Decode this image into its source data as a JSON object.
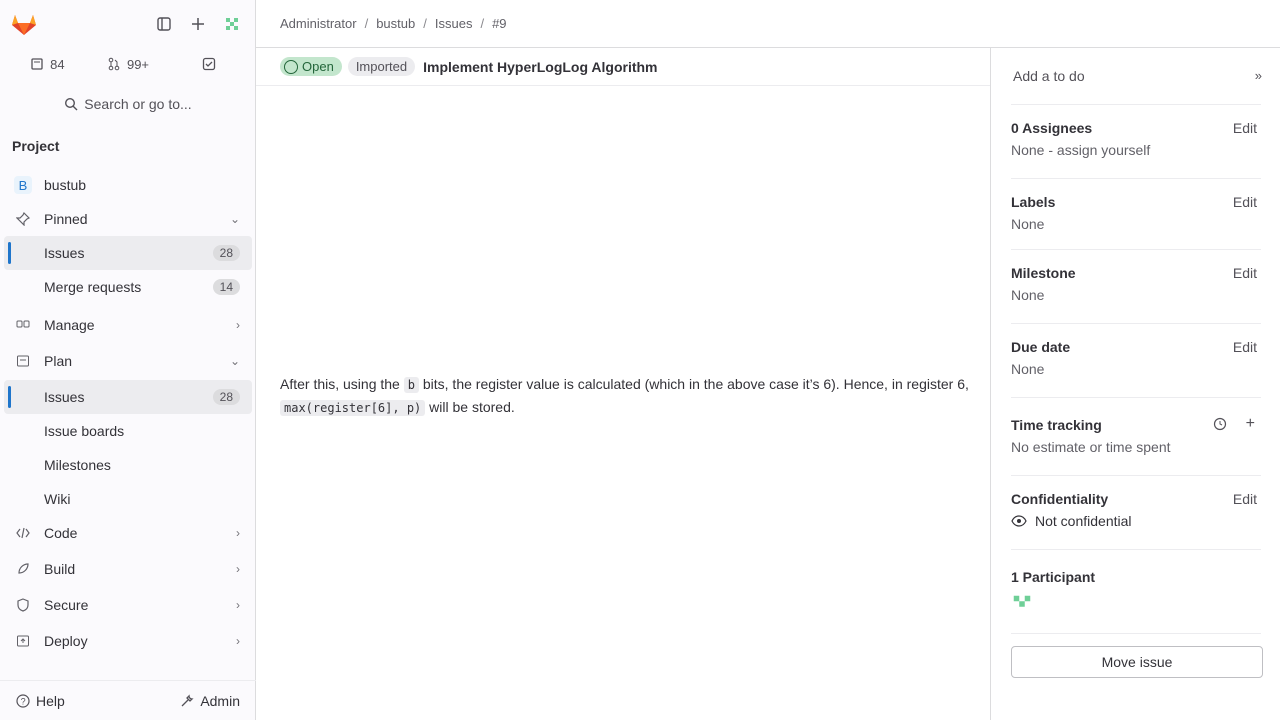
{
  "sidebar": {
    "counters": {
      "issues": "84",
      "merge_requests": "99+"
    },
    "search_label": "Search or go to...",
    "section_title": "Project",
    "project_avatar_letter": "B",
    "project_name": "bustub",
    "items": {
      "pinned": "Pinned",
      "pinned_issues": "Issues",
      "pinned_issues_count": "28",
      "pinned_mr": "Merge requests",
      "pinned_mr_count": "14",
      "manage": "Manage",
      "plan": "Plan",
      "plan_issues": "Issues",
      "plan_issues_count": "28",
      "issue_boards": "Issue boards",
      "milestones": "Milestones",
      "wiki": "Wiki",
      "code": "Code",
      "build": "Build",
      "secure": "Secure",
      "deploy": "Deploy"
    },
    "help": "Help",
    "admin": "Admin"
  },
  "breadcrumb": [
    "Administrator",
    "bustub",
    "Issues",
    "#9"
  ],
  "issue": {
    "status": "Open",
    "imported": "Imported",
    "title": "Implement HyperLogLog Algorithm"
  },
  "content": {
    "para_a": "After this, using the ",
    "code_b": "b",
    "para_b": " bits, the register value is calculated (which in the above case it’s 6). Hence, in register 6, ",
    "code_max": "max(register[6], p)",
    "para_c": " will be stored."
  },
  "right_sidebar": {
    "todo": "Add a to do",
    "assignees_title": "0 Assignees",
    "assignees_none": "None - ",
    "assign_yourself": "assign yourself",
    "labels_title": "Labels",
    "labels_val": "None",
    "milestone_title": "Milestone",
    "milestone_val": "None",
    "due_title": "Due date",
    "due_val": "None",
    "time_title": "Time tracking",
    "time_val": "No estimate or time spent",
    "conf_title": "Confidentiality",
    "conf_val": "Not confidential",
    "participants_title": "1 Participant",
    "edit": "Edit",
    "move_issue": "Move issue"
  },
  "colors": {
    "accent": "#1f75cb",
    "open_bg": "#c3e6cd",
    "open_fg": "#24663b"
  }
}
